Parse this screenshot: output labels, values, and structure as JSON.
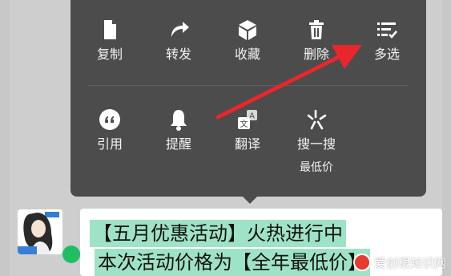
{
  "menu": {
    "row1": [
      {
        "id": "copy",
        "label": "复制",
        "icon": "document-icon"
      },
      {
        "id": "forward",
        "label": "转发",
        "icon": "forward-arrow-icon"
      },
      {
        "id": "favorite",
        "label": "收藏",
        "icon": "cube-icon"
      },
      {
        "id": "delete",
        "label": "删除",
        "icon": "trash-icon"
      },
      {
        "id": "multiselect",
        "label": "多选",
        "icon": "checklist-icon"
      }
    ],
    "row2": [
      {
        "id": "quote",
        "label": "引用",
        "icon": "quote-icon"
      },
      {
        "id": "remind",
        "label": "提醒",
        "icon": "bell-icon"
      },
      {
        "id": "translate",
        "label": "翻译",
        "icon": "translate-icon"
      },
      {
        "id": "search",
        "label": "搜一搜",
        "sublabel": "最低价",
        "icon": "sparkle-icon"
      }
    ]
  },
  "message": {
    "line1": "【五月优惠活动】火热进行中",
    "line2": "本次活动价格为【全年最低价】"
  },
  "watermark": {
    "text": "爱创根知识网"
  },
  "colors": {
    "menu_bg": "#4c4c4c",
    "selection": "#9fe3c6",
    "handle": "#1fbe63",
    "arrow": "#e8262c"
  }
}
